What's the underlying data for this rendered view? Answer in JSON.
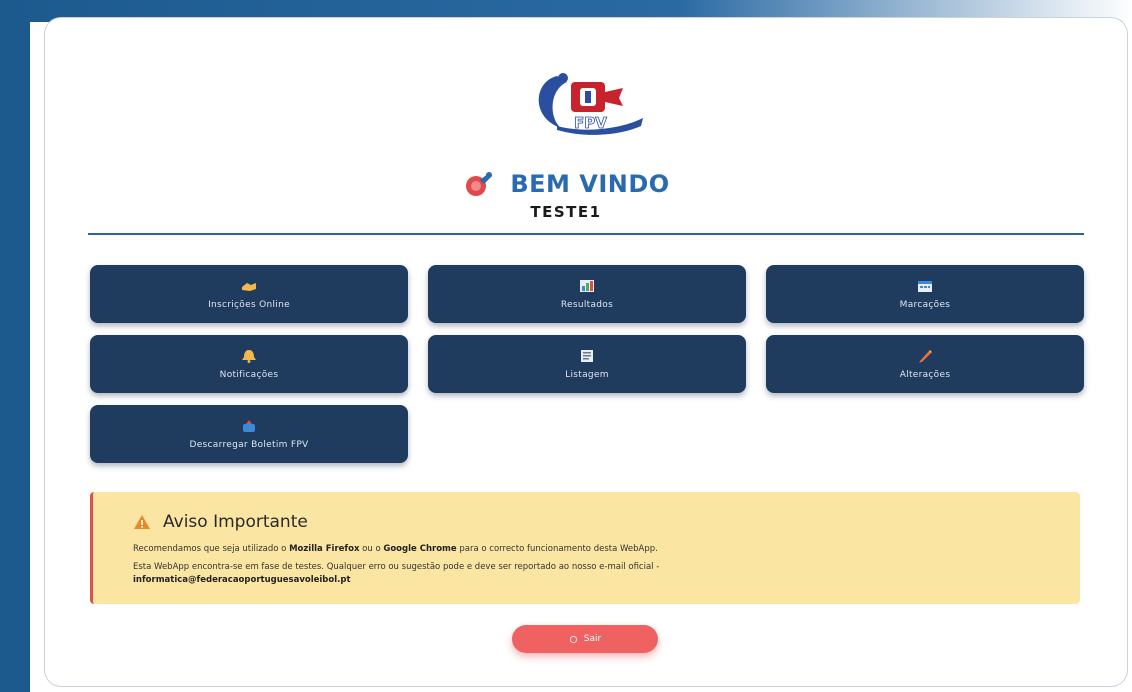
{
  "header": {
    "logo_text": "FPV",
    "welcome": "BEM VINDO",
    "username": "TESTE1"
  },
  "menu": {
    "tiles": [
      {
        "label": "Inscrições Online",
        "icon": "handshake-icon"
      },
      {
        "label": "Resultados",
        "icon": "chart-icon"
      },
      {
        "label": "Marcações",
        "icon": "calendar-icon"
      },
      {
        "label": "Notificações",
        "icon": "bell-icon"
      },
      {
        "label": "Listagem",
        "icon": "list-icon"
      },
      {
        "label": "Alterações",
        "icon": "pencil-icon"
      },
      {
        "label": "Descarregar Boletim FPV",
        "icon": "download-icon"
      }
    ]
  },
  "notice": {
    "title": "Aviso Importante",
    "line1_pre": "Recomendamos que seja utilizado o ",
    "line1_b1": "Mozilla Firefox",
    "line1_mid": " ou o ",
    "line1_b2": "Google Chrome",
    "line1_post": " para o correcto funcionamento desta WebApp.",
    "line2": "Esta WebApp encontra-se em fase de testes. Qualquer erro ou sugestão pode e deve ser reportado ao nosso e-mail oficial -",
    "email": "informatica@federacaoportuguesavoleibol.pt"
  },
  "actions": {
    "logout_label": "Sair"
  },
  "colors": {
    "tile_bg": "#1f3b5e",
    "accent_blue": "#2a6ab0",
    "warning_bg": "#fbe5a3",
    "warning_border": "#d9534f",
    "logout_bg": "#f06262"
  }
}
